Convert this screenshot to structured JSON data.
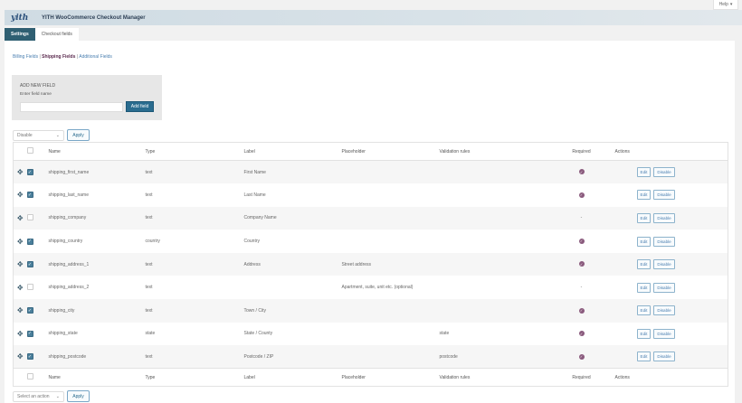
{
  "help": {
    "label": "Help"
  },
  "plugin": {
    "title": "YITH WooCommerce Checkout Manager",
    "logo": "yith"
  },
  "tabs": [
    {
      "label": "Settings"
    },
    {
      "label": "Checkout fields"
    }
  ],
  "subnav": {
    "billing": "Billing Fields",
    "shipping": "Shipping Fields",
    "additional": "Additional Fields",
    "sep": "|"
  },
  "add": {
    "heading": "ADD NEW FIELD",
    "label": "Enter field name",
    "value": "",
    "button": "Add field"
  },
  "bulk_top": {
    "selected": "Disable",
    "apply": "Apply"
  },
  "bulk_bottom": {
    "selected": "Select an action",
    "apply": "Apply"
  },
  "columns": {
    "name": "Name",
    "type": "Type",
    "label": "Label",
    "placeholder": "Placeholder",
    "validation": "Validation rules",
    "required": "Required",
    "actions": "Actions"
  },
  "rows": [
    {
      "checked": true,
      "name": "shipping_first_name",
      "type": "text",
      "label": "First Name",
      "placeholder": "",
      "validation": "",
      "required": true,
      "required_text": "",
      "edit": "Edit",
      "disable": "Disable"
    },
    {
      "checked": true,
      "name": "shipping_last_name",
      "type": "text",
      "label": "Last Name",
      "placeholder": "",
      "validation": "",
      "required": true,
      "required_text": "",
      "edit": "Edit",
      "disable": "Disable"
    },
    {
      "checked": false,
      "name": "shipping_company",
      "type": "text",
      "label": "Company Name",
      "placeholder": "",
      "validation": "",
      "required": false,
      "required_text": "-",
      "edit": "Edit",
      "disable": "Disable"
    },
    {
      "checked": true,
      "name": "shipping_country",
      "type": "country",
      "label": "Country",
      "placeholder": "",
      "validation": "",
      "required": true,
      "required_text": "",
      "edit": "Edit",
      "disable": "Disable"
    },
    {
      "checked": true,
      "name": "shipping_address_1",
      "type": "text",
      "label": "Address",
      "placeholder": "Street address",
      "validation": "",
      "required": true,
      "required_text": "",
      "edit": "Edit",
      "disable": "Disable"
    },
    {
      "checked": false,
      "name": "shipping_address_2",
      "type": "text",
      "label": "",
      "placeholder": "Apartment, suite, unit etc. (optional)",
      "validation": "",
      "required": false,
      "required_text": "-",
      "edit": "Edit",
      "disable": "Disable"
    },
    {
      "checked": true,
      "name": "shipping_city",
      "type": "text",
      "label": "Town / City",
      "placeholder": "",
      "validation": "",
      "required": true,
      "required_text": "",
      "edit": "Edit",
      "disable": "Disable"
    },
    {
      "checked": true,
      "name": "shipping_state",
      "type": "state",
      "label": "State / County",
      "placeholder": "",
      "validation": "state",
      "required": true,
      "required_text": "",
      "edit": "Edit",
      "disable": "Disable"
    },
    {
      "checked": true,
      "name": "shipping_postcode",
      "type": "text",
      "label": "Postcode / ZIP",
      "placeholder": "",
      "validation": "postcode",
      "required": true,
      "required_text": "",
      "edit": "Edit",
      "disable": "Disable"
    }
  ],
  "colors": {
    "accent": "#2a6c8f",
    "tab_active": "#2f5f72",
    "required_icon": "#8a5a7d"
  }
}
